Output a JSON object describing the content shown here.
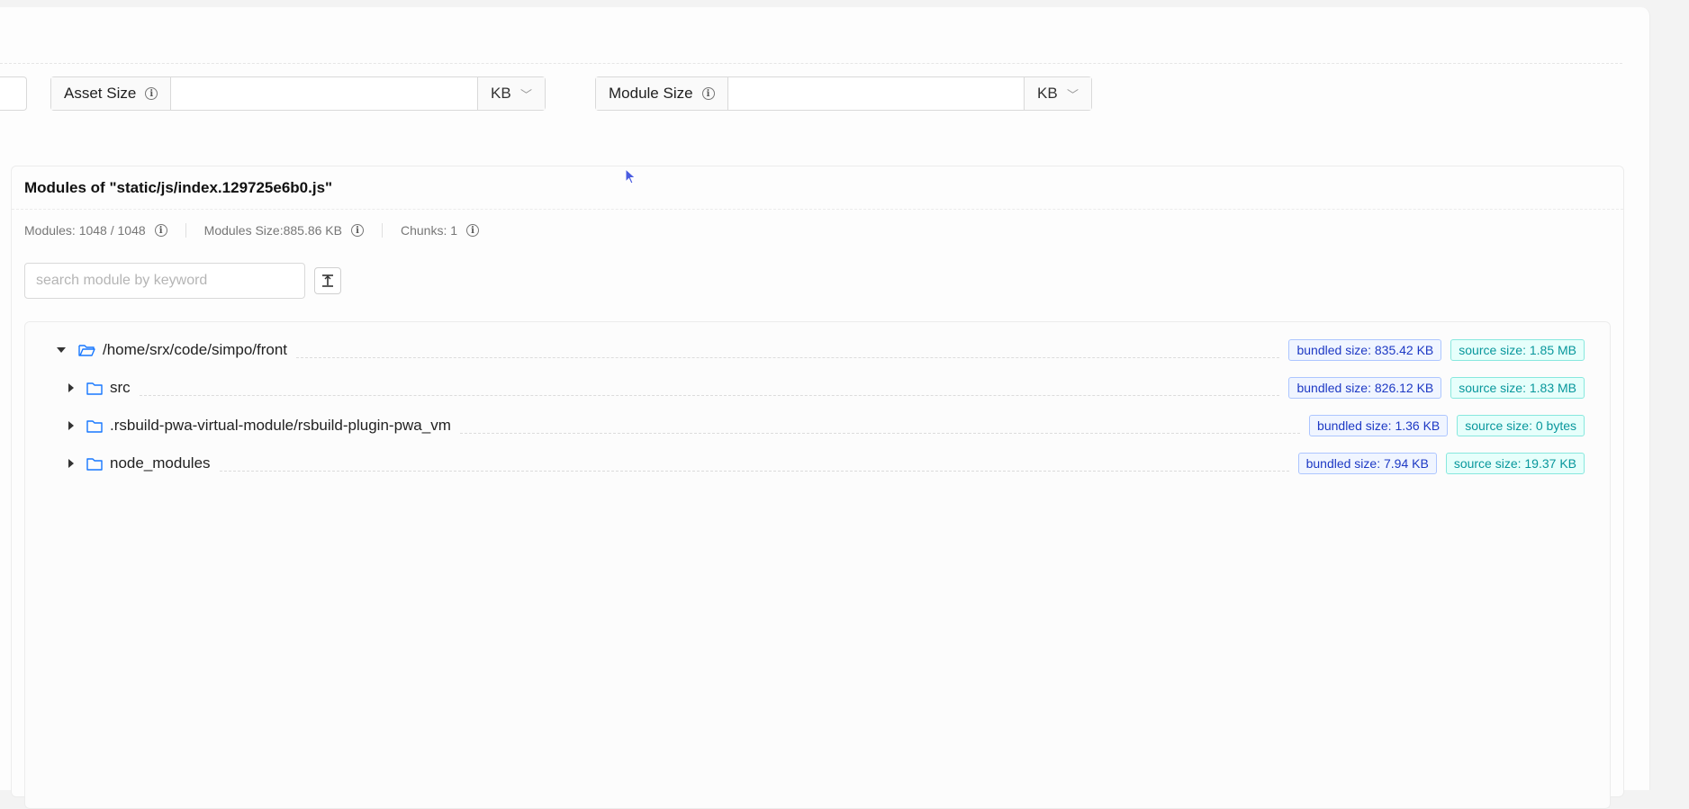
{
  "filters": {
    "asset_size": {
      "label": "Asset Size",
      "value": "",
      "unit": "KB"
    },
    "module_size": {
      "label": "Module Size",
      "value": "",
      "unit": "KB"
    }
  },
  "modules_panel": {
    "title": "Modules of \"static/js/index.129725e6b0.js\"",
    "stats": {
      "modules": "Modules: 1048 / 1048",
      "modules_size": "Modules Size:885.86 KB",
      "chunks": "Chunks: 1"
    },
    "search": {
      "placeholder": "search module by keyword",
      "value": ""
    },
    "tree": [
      {
        "label": "/home/srx/code/simpo/front",
        "expanded": true,
        "depth": 0,
        "bundled": "bundled size: 835.42 KB",
        "source": "source size: 1.85 MB"
      },
      {
        "label": "src",
        "expanded": false,
        "depth": 1,
        "bundled": "bundled size: 826.12 KB",
        "source": "source size: 1.83 MB"
      },
      {
        "label": ".rsbuild-pwa-virtual-module/rsbuild-plugin-pwa_vm",
        "expanded": false,
        "depth": 1,
        "bundled": "bundled size: 1.36 KB",
        "source": "source size: 0 bytes"
      },
      {
        "label": "node_modules",
        "expanded": false,
        "depth": 1,
        "bundled": "bundled size: 7.94 KB",
        "source": "source size: 19.37 KB"
      }
    ]
  },
  "icons": {
    "info": "info-icon",
    "dropdown": "chevron-down-icon",
    "folder": "folder-icon",
    "folder_open": "folder-open-icon",
    "collapse": "collapse-all-icon",
    "cursor": "mouse-pointer-icon"
  },
  "colors": {
    "bundled_tag": "#1d39c4",
    "source_tag": "#08979c",
    "folder_icon": "#1677ff"
  }
}
